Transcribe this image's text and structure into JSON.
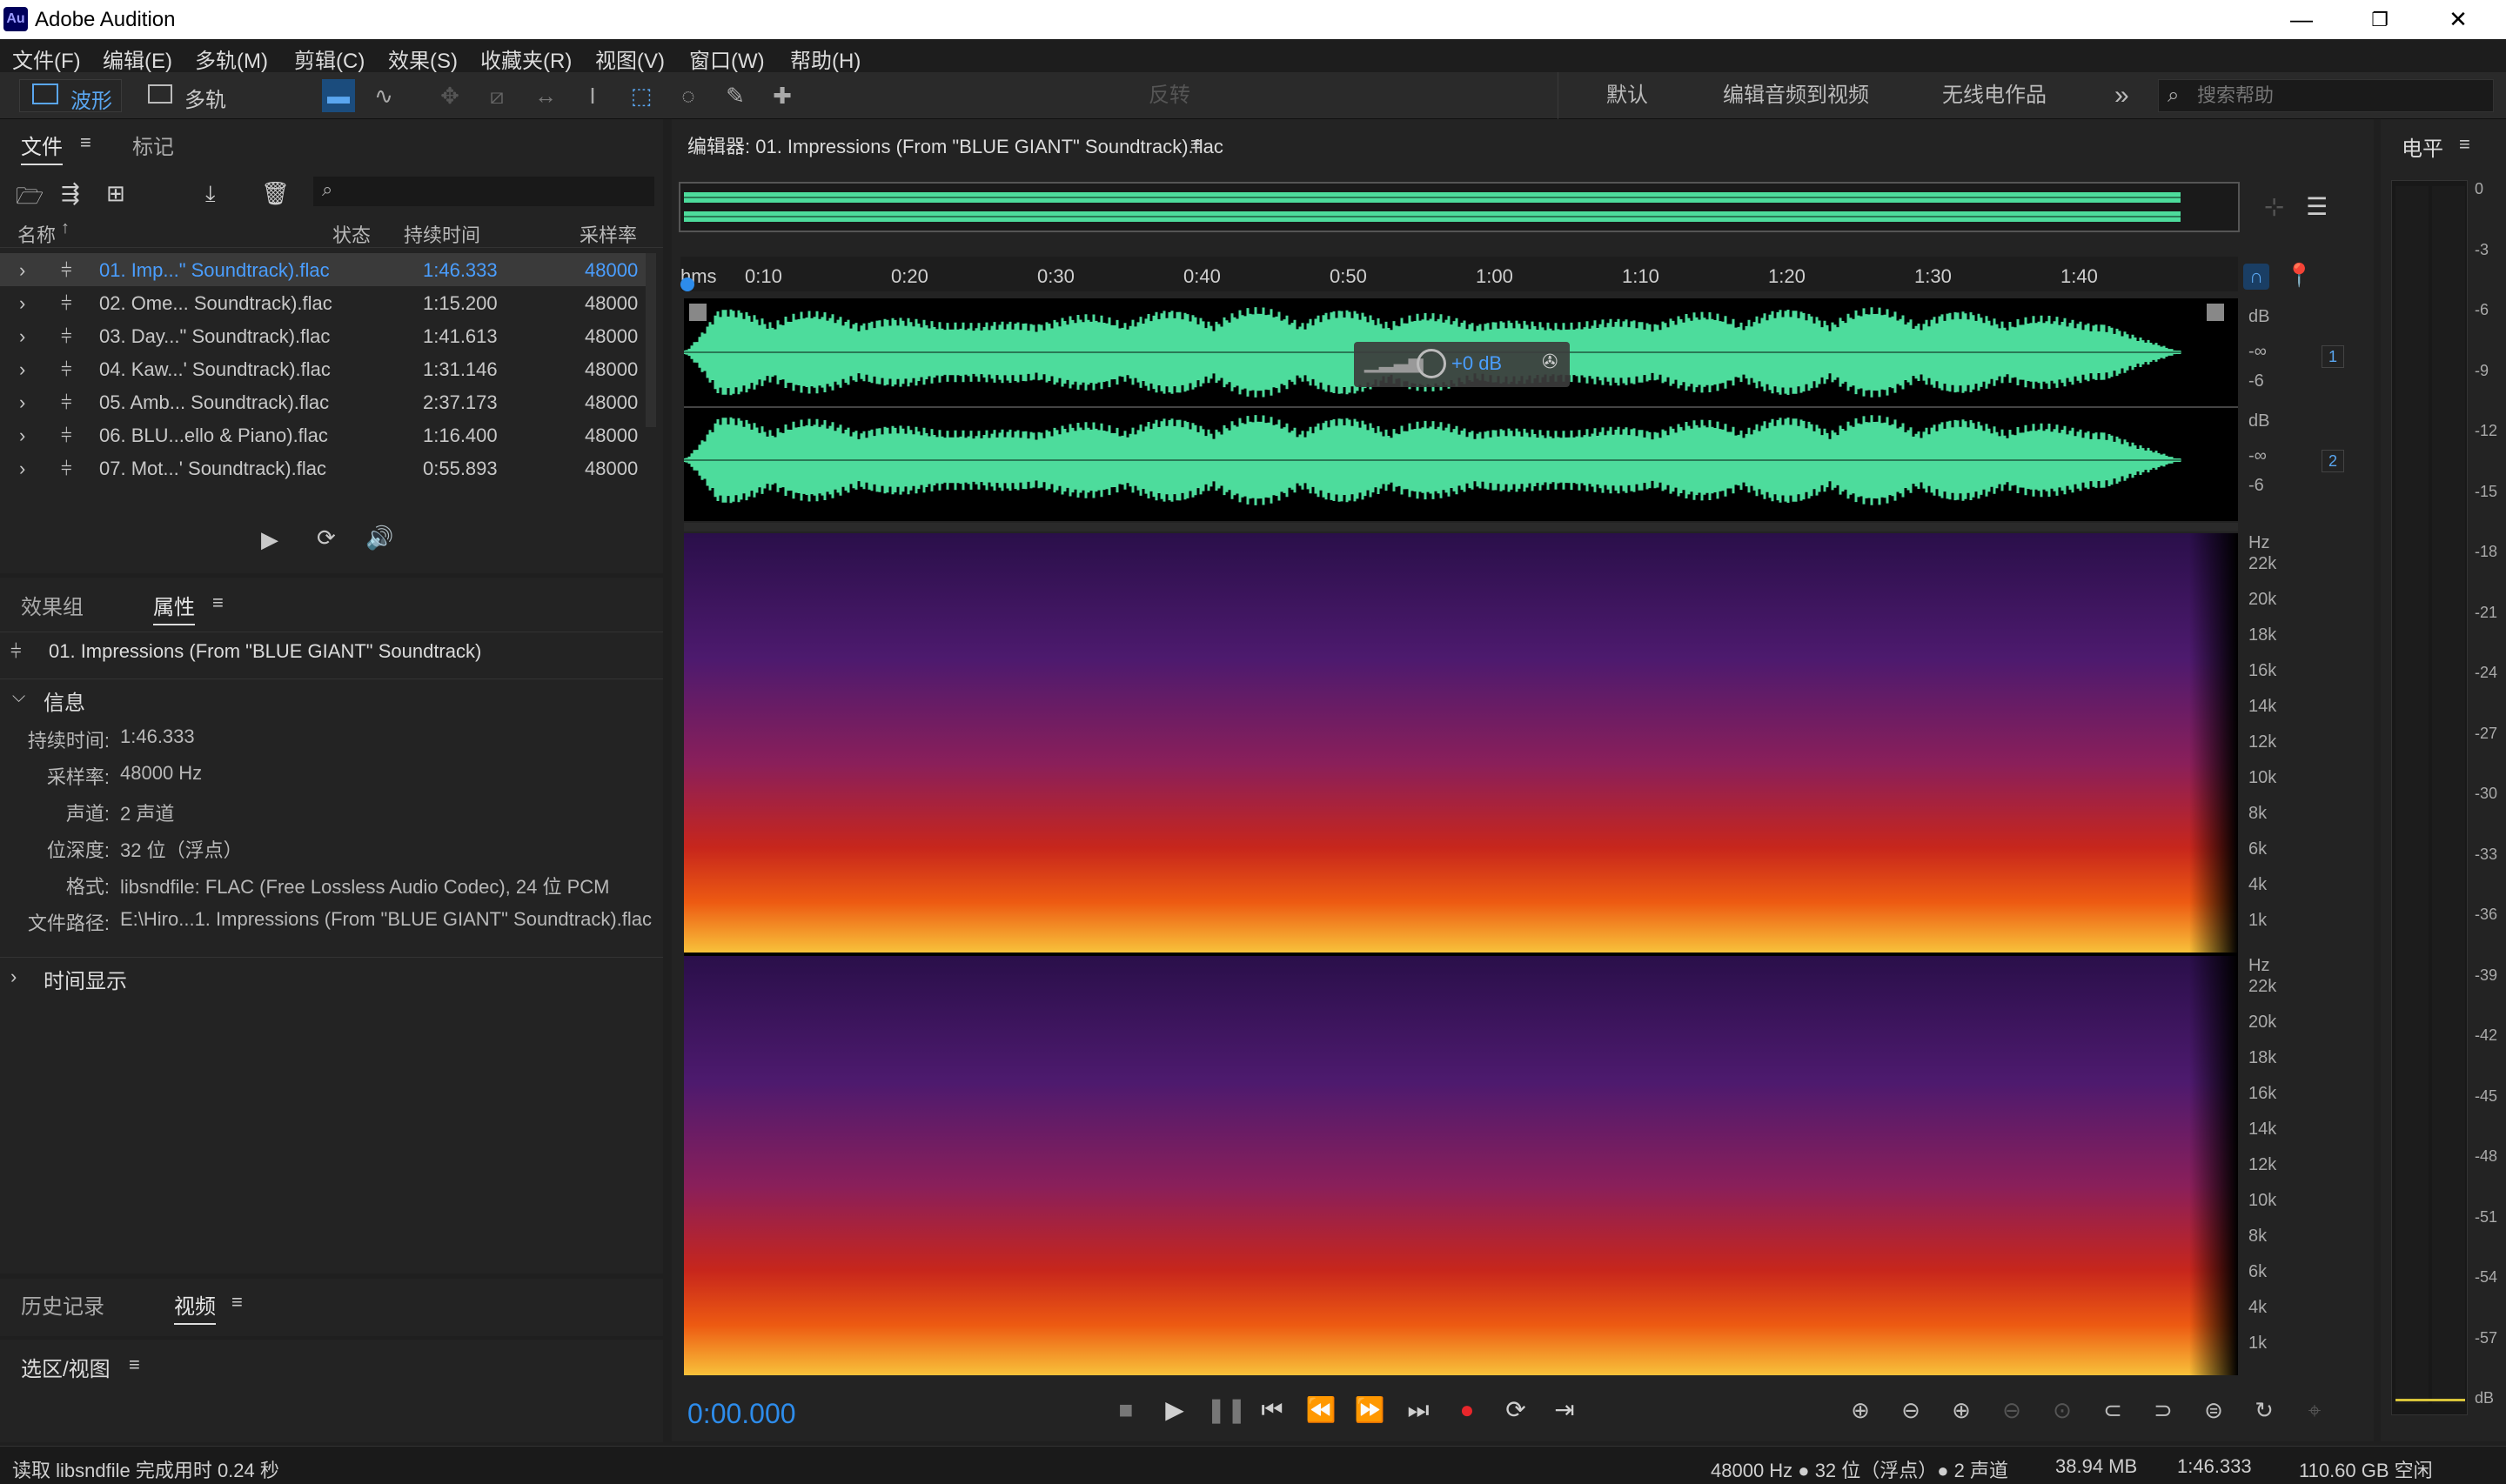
{
  "app": {
    "logo": "Au",
    "title": "Adobe Audition"
  },
  "window_controls": {
    "minimize": "—",
    "maximize": "❐",
    "close": "✕"
  },
  "menu": [
    "文件(F)",
    "编辑(E)",
    "多轨(M)",
    "剪辑(C)",
    "效果(S)",
    "收藏夹(R)",
    "视图(V)",
    "窗口(W)",
    "帮助(H)"
  ],
  "toolbar": {
    "waveform_label": "波形",
    "multitrack_label": "多轨",
    "feedback_label": "反转",
    "workspaces": [
      "默认",
      "编辑音频到视频",
      "无线电作品"
    ],
    "more": "»",
    "search_placeholder": "搜索帮助"
  },
  "files_panel": {
    "tabs": [
      "文件",
      "标记"
    ],
    "columns": [
      "名称",
      "状态",
      "持续时间",
      "采样率"
    ],
    "rows": [
      {
        "name": "01. Imp...\" Soundtrack).flac",
        "duration": "1:46.333",
        "rate": "48000"
      },
      {
        "name": "02. Ome... Soundtrack).flac",
        "duration": "1:15.200",
        "rate": "48000"
      },
      {
        "name": "03. Day...\" Soundtrack).flac",
        "duration": "1:41.613",
        "rate": "48000"
      },
      {
        "name": "04. Kaw...' Soundtrack).flac",
        "duration": "1:31.146",
        "rate": "48000"
      },
      {
        "name": "05. Amb... Soundtrack).flac",
        "duration": "2:37.173",
        "rate": "48000"
      },
      {
        "name": "06. BLU...ello & Piano).flac",
        "duration": "1:16.400",
        "rate": "48000"
      },
      {
        "name": "07. Mot...' Soundtrack).flac",
        "duration": "0:55.893",
        "rate": "48000"
      }
    ]
  },
  "properties_panel": {
    "tabs": [
      "效果组",
      "属性"
    ],
    "file_title": "01. Impressions (From \"BLUE GIANT\" Soundtrack)",
    "section_info": "信息",
    "info": [
      {
        "k": "持续时间:",
        "v": "1:46.333"
      },
      {
        "k": "采样率:",
        "v": "48000 Hz"
      },
      {
        "k": "声道:",
        "v": "2 声道"
      },
      {
        "k": "位深度:",
        "v": "32 位（浮点）"
      },
      {
        "k": "格式:",
        "v": "libsndfile: FLAC (Free Lossless Audio Codec), 24 位 PCM"
      },
      {
        "k": "文件路径:",
        "v": "E:\\Hiro...1. Impressions (From \"BLUE GIANT\" Soundtrack).flac"
      }
    ],
    "section_time": "时间显示"
  },
  "bottom_panels": {
    "history": "历史记录",
    "video": "视频",
    "selection": "选区/视图"
  },
  "editor": {
    "title": "编辑器: 01. Impressions (From \"BLUE GIANT\" Soundtrack).flac",
    "ruler_unit": "hms",
    "ruler": [
      "0:10",
      "0:20",
      "0:30",
      "0:40",
      "0:50",
      "1:00",
      "1:10",
      "1:20",
      "1:30",
      "1:40"
    ],
    "hud_gain": "+0 dB",
    "channel_numbers": [
      "1",
      "2"
    ],
    "db_scale": [
      "dB",
      "-∞",
      "-6"
    ],
    "hz_scale": [
      "Hz",
      "22k",
      "20k",
      "18k",
      "16k",
      "14k",
      "12k",
      "10k",
      "8k",
      "6k",
      "4k",
      "1k"
    ],
    "time_display": "0:00.000"
  },
  "level_meter": {
    "title": "电平",
    "scale": [
      "0",
      "-3",
      "-6",
      "-9",
      "-12",
      "-15",
      "-18",
      "-21",
      "-24",
      "-27",
      "-30",
      "-33",
      "-36",
      "-39",
      "-42",
      "-45",
      "-48",
      "-51",
      "-54",
      "-57",
      "dB"
    ]
  },
  "status_bar": {
    "message": "读取 libsndfile 完成用时 0.24 秒",
    "sample_rate": "48000 Hz ● 32 位（浮点）● 2 声道",
    "size": "38.94 MB",
    "duration": "1:46.333",
    "free": "110.60 GB 空闲"
  },
  "colors": {
    "accent": "#2d8ceb",
    "waveform": "#4ddc9c",
    "record": "#e8262b",
    "background": "#1f1f1f"
  }
}
